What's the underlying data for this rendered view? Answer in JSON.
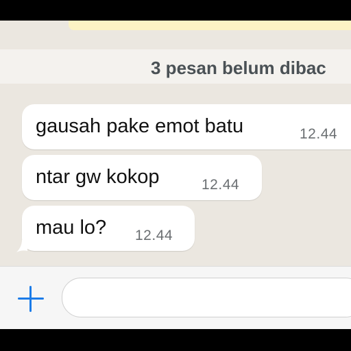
{
  "chat": {
    "unread_divider": "3 pesan belum dibac",
    "messages": [
      {
        "text": "gausah pake emot batu",
        "time": "12.44"
      },
      {
        "text": "ntar gw kokop",
        "time": "12.44"
      },
      {
        "text": "mau lo?",
        "time": "12.44"
      }
    ]
  },
  "composer": {
    "add_icon": "plus-icon",
    "input_value": ""
  },
  "colors": {
    "accent": "#1b7be8",
    "chat_background": "#ebe7e0",
    "bubble": "#ffffff",
    "pinned_banner": "#fcf3c4"
  }
}
